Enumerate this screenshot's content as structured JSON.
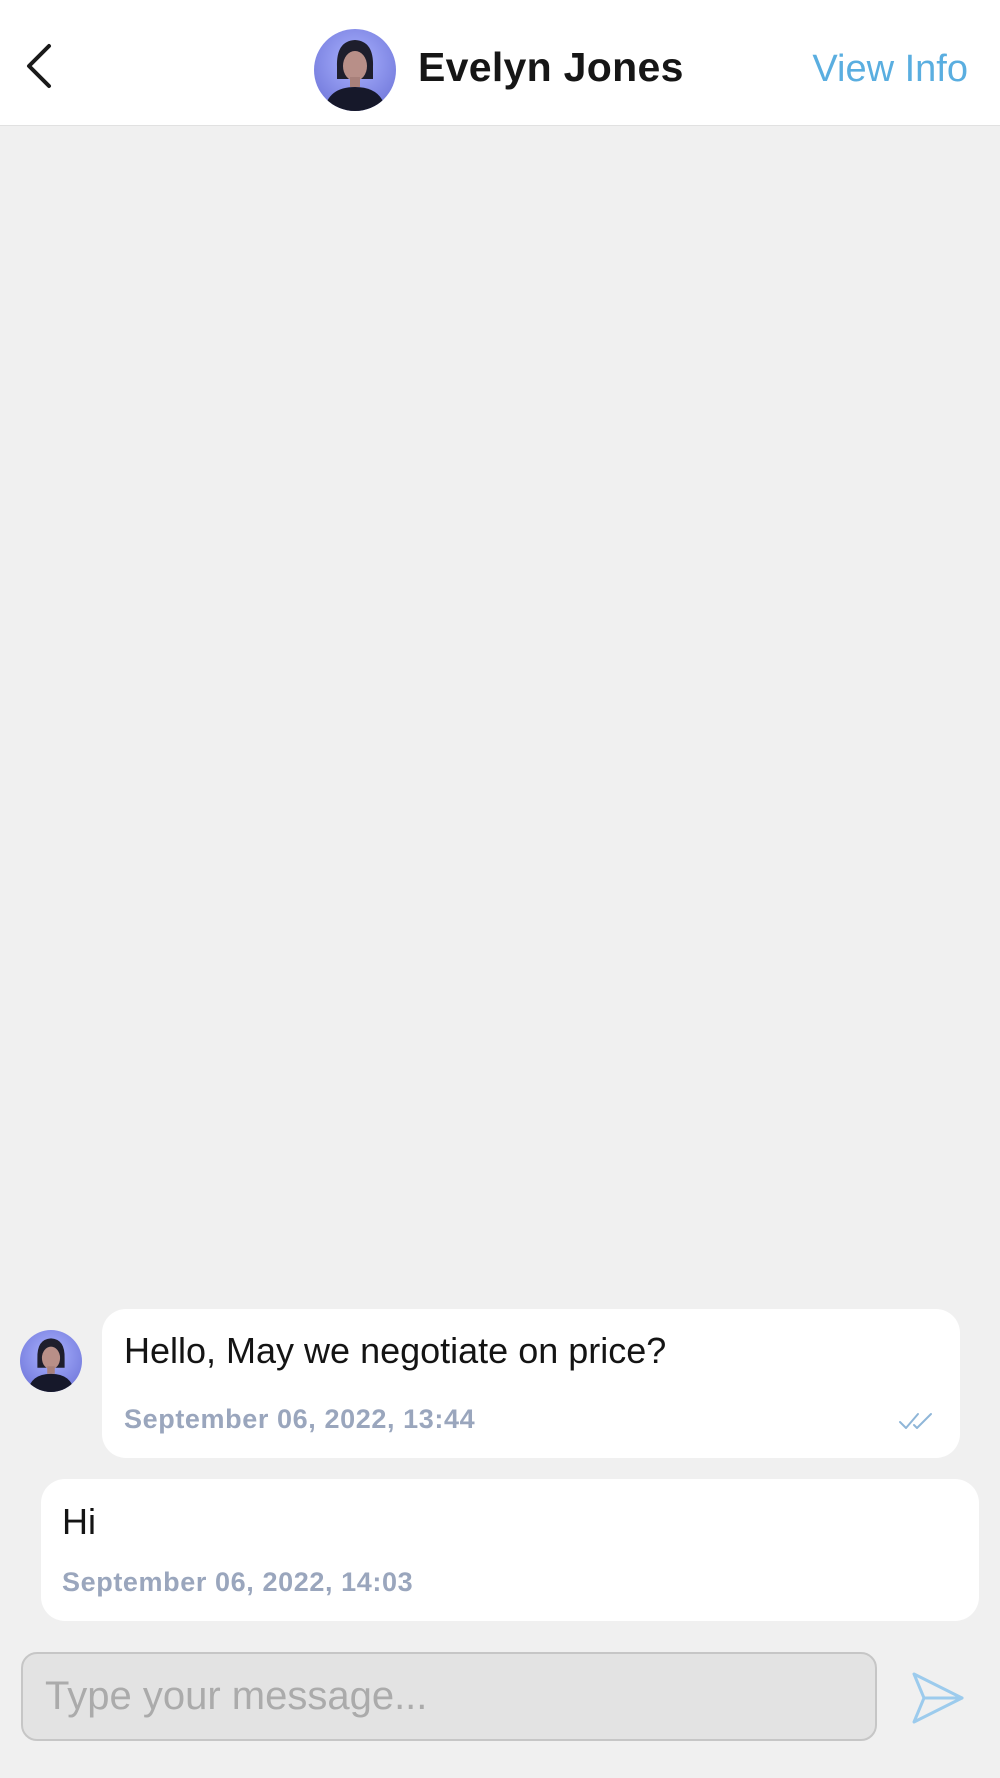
{
  "header": {
    "back_icon": "chevron-left-icon",
    "contact_name": "Evelyn Jones",
    "view_info_label": "View Info",
    "avatar_icon": "contact-avatar",
    "accent_color": "#5aaee0"
  },
  "messages": [
    {
      "direction": "incoming",
      "text": "Hello, May we negotiate on price?",
      "timestamp": "September 06, 2022, 13:44",
      "status_icon": "double-check-icon"
    },
    {
      "direction": "outgoing",
      "text": "Hi",
      "timestamp": "September 06, 2022, 14:03"
    }
  ],
  "composer": {
    "placeholder": "Type your message...",
    "value": "",
    "send_icon": "send-icon"
  },
  "colors": {
    "background": "#f0f0f0",
    "bubble": "#ffffff",
    "timestamp": "#9aa6bd",
    "composer_fill": "#e3e3e3"
  }
}
